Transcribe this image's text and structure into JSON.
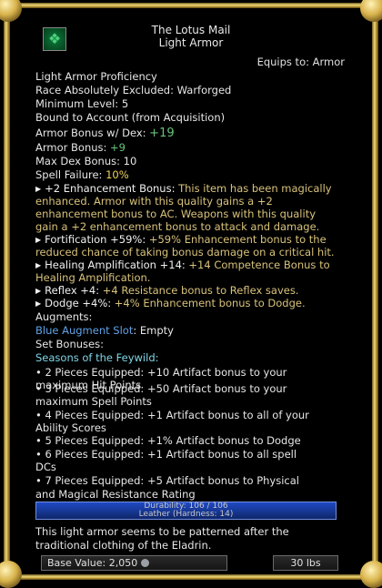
{
  "item": {
    "name": "The Lotus Mail",
    "type": "Light Armor",
    "equips_to": "Equips to:  Armor",
    "icon": "armor-icon"
  },
  "requirements": [
    "Light Armor Proficiency",
    "Race Absolutely Excluded: Warforged",
    "Minimum Level: 5",
    "Bound to Account (from Acquisition)"
  ],
  "stats": {
    "armor_bonus_dex_label": "Armor Bonus w/ Dex:",
    "armor_bonus_dex_value": "+19",
    "armor_bonus_label": "Armor Bonus:",
    "armor_bonus_value": "+9",
    "max_dex_label": "Max Dex Bonus:",
    "max_dex_value": "10",
    "spell_failure_label": "Spell Failure:",
    "spell_failure_value": "10%"
  },
  "effects": {
    "enh_name": "+2 Enhancement Bonus:",
    "enh_desc_1": " This item has been magically",
    "enh_desc_2": "enhanced. Armor with this quality gains a +2",
    "enh_desc_3": "enhancement bonus to AC. Weapons with this quality",
    "enh_desc_4": "gain a +2 enhancement bonus to attack and damage.",
    "fort_name": "Fortification +59%:",
    "fort_desc_1": " +59% Enhancement bonus to the",
    "fort_desc_2": "reduced chance of taking bonus damage on a critical hit.",
    "heal_name": "Healing Amplification +14:",
    "heal_desc_1": " +14 Competence Bonus to",
    "heal_desc_2": "Healing Amplification.",
    "reflex_name": "Reflex +4:",
    "reflex_desc": " +4 Resistance bonus to Reflex saves.",
    "dodge_name": "Dodge +4%:",
    "dodge_desc": " +4% Enhancement bonus to Dodge."
  },
  "augments": {
    "label": "Augments:",
    "slot_label": "Blue Augment Slot",
    "slot_value": ": Empty"
  },
  "set": {
    "label": "Set Bonuses:",
    "name": "Seasons of the Feywild:",
    "lines": [
      "• 2 Pieces Equipped: +10 Artifact bonus to your",
      "maximum Hit Points",
      "• 3 Pieces Equipped: +50 Artifact bonus to your",
      "maximum Spell Points",
      "• 4 Pieces Equipped: +1 Artifact bonus to all of your",
      "Ability Scores",
      "• 5 Pieces Equipped: +1% Artifact bonus to Dodge",
      "• 6 Pieces Equipped: +1 Artifact bonus to all spell",
      "DCs",
      "• 7 Pieces Equipped: +5 Artifact bonus to Physical",
      "and Magical Resistance Rating"
    ]
  },
  "durability": {
    "line1": "Durability: 106 / 106",
    "line2": "Leather (Hardness: 14)",
    "fraction": 1.0
  },
  "description": [
    "This light armor seems to be patterned after the",
    "traditional clothing of the Eladrin."
  ],
  "footer": {
    "base_value_label": "Base Value:",
    "base_value": "2,050",
    "weight": "30 lbs"
  },
  "colors": {
    "positive": "#67c47a",
    "highlight": "#f1d35a",
    "description": "#d8c27a",
    "augment": "#5fa3e6",
    "set_name": "#7fd6e6",
    "frame_gold": "#d8b24a"
  }
}
